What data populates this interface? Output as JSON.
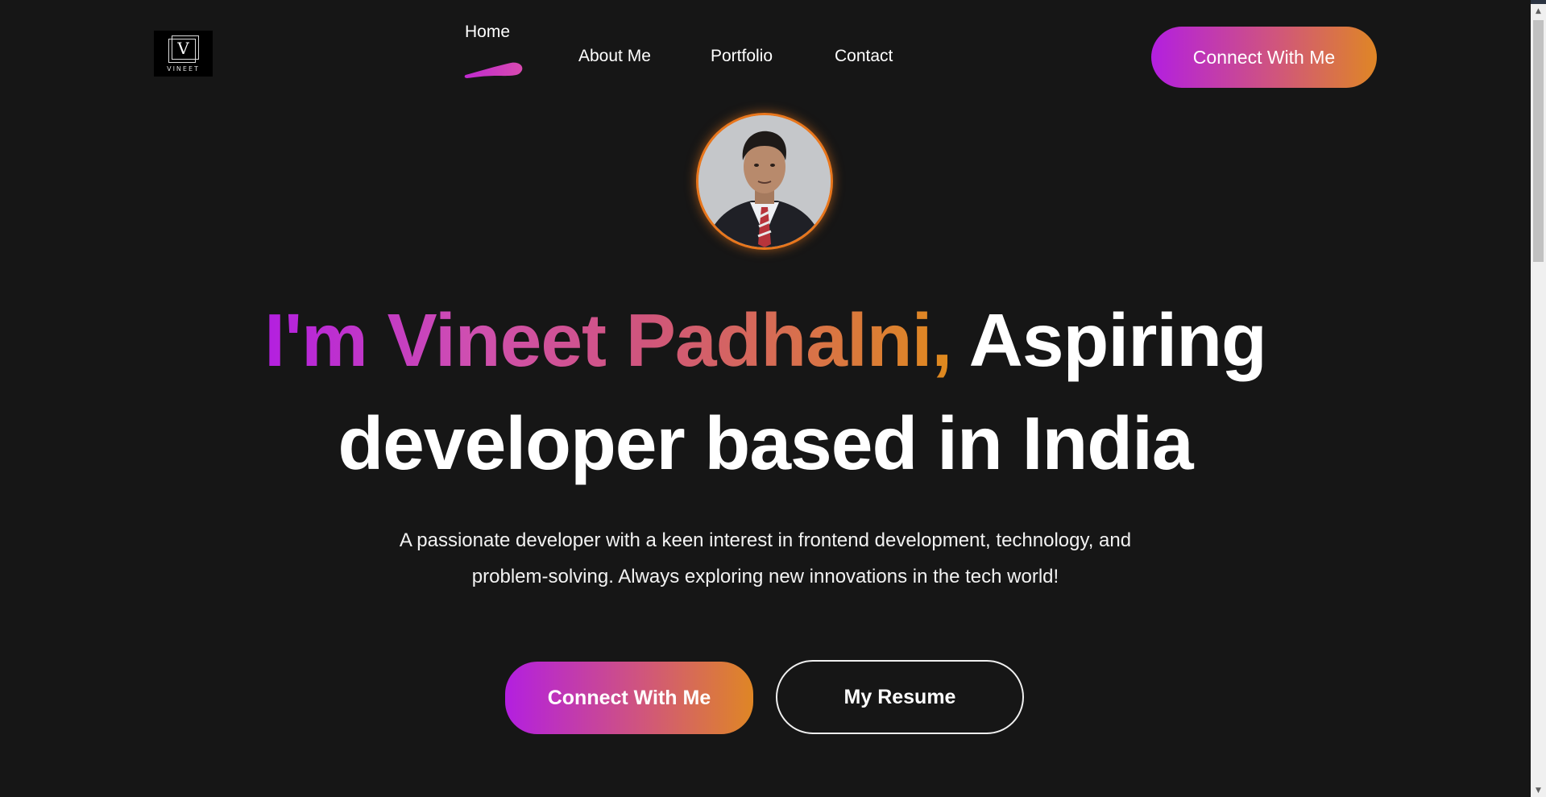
{
  "logo": {
    "letter": "V",
    "name": "VINEET"
  },
  "nav": {
    "items": [
      {
        "label": "Home",
        "active": true
      },
      {
        "label": "About Me"
      },
      {
        "label": "Portfolio"
      },
      {
        "label": "Contact"
      }
    ]
  },
  "header": {
    "cta_label": "Connect With Me"
  },
  "hero": {
    "avatar_alt": "profile-photo",
    "headline_highlight": "I'm Vineet Padhalni,",
    "headline_rest_line1": "Aspiring",
    "headline_line2": "developer based in India",
    "description": "A passionate developer with a keen interest in frontend development, technology, and problem-solving. Always exploring new innovations in the tech world!",
    "primary_cta": "Connect With Me",
    "secondary_cta": "My Resume"
  },
  "colors": {
    "background": "#161616",
    "gradient_start": "#b31fe0",
    "gradient_mid": "#d0557d",
    "gradient_end": "#df8625",
    "avatar_ring": "#e8761c"
  }
}
